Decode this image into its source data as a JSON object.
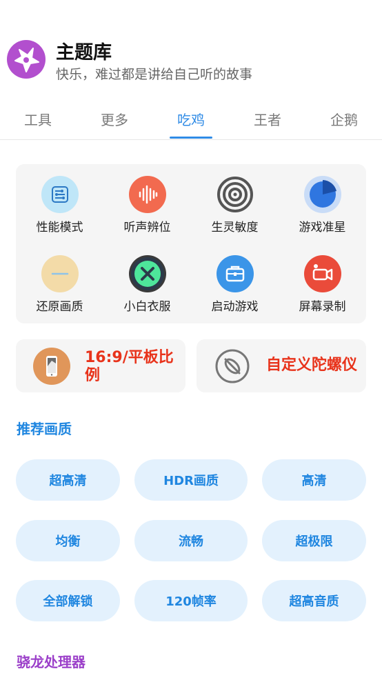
{
  "header": {
    "title": "主题库",
    "subtitle": "快乐，难过都是讲给自己听的故事"
  },
  "tabs": [
    {
      "label": "工具"
    },
    {
      "label": "更多"
    },
    {
      "label": "吃鸡",
      "active": true
    },
    {
      "label": "王者"
    },
    {
      "label": "企鹅"
    }
  ],
  "features": [
    {
      "label": "性能模式",
      "icon": "circuit-icon",
      "color": "#bfe6f8"
    },
    {
      "label": "听声辨位",
      "icon": "sound-wave-icon",
      "color": "#f26a4f"
    },
    {
      "label": "生灵敏度",
      "icon": "target-icon",
      "color": "#e8e8e8"
    },
    {
      "label": "游戏准星",
      "icon": "pie-icon",
      "color": "#c9dcf7"
    },
    {
      "label": "还原画质",
      "icon": "dash-icon",
      "color": "#f3dba8"
    },
    {
      "label": "小白衣服",
      "icon": "close-circle-icon",
      "color": "#4ee69b"
    },
    {
      "label": "启动游戏",
      "icon": "briefcase-icon",
      "color": "#3b95e8"
    },
    {
      "label": "屏幕录制",
      "icon": "video-camera-icon",
      "color": "#ea4b3a"
    }
  ],
  "mid_cards": [
    {
      "label": "16:9/平板比例",
      "icon": "tablet-icon",
      "color": "#e0965a"
    },
    {
      "label": "自定义陀螺仪",
      "icon": "gyroscope-icon",
      "color": "#ffffff"
    }
  ],
  "sections": {
    "recommend_title": "推荐画质",
    "recommend_color": "#1f86e0",
    "snapdragon_title": "骁龙处理器",
    "snapdragon_color": "#9b3fc9"
  },
  "quality_options": [
    "超高清",
    "HDR画质",
    "高清",
    "均衡",
    "流畅",
    "超极限",
    "全部解锁",
    "120帧率",
    "超高音质"
  ],
  "colors": {
    "accent": "#2f8be6",
    "pill_bg": "#e3f1fd",
    "pill_text": "#1f86e0",
    "highlight_red": "#e8331b"
  }
}
